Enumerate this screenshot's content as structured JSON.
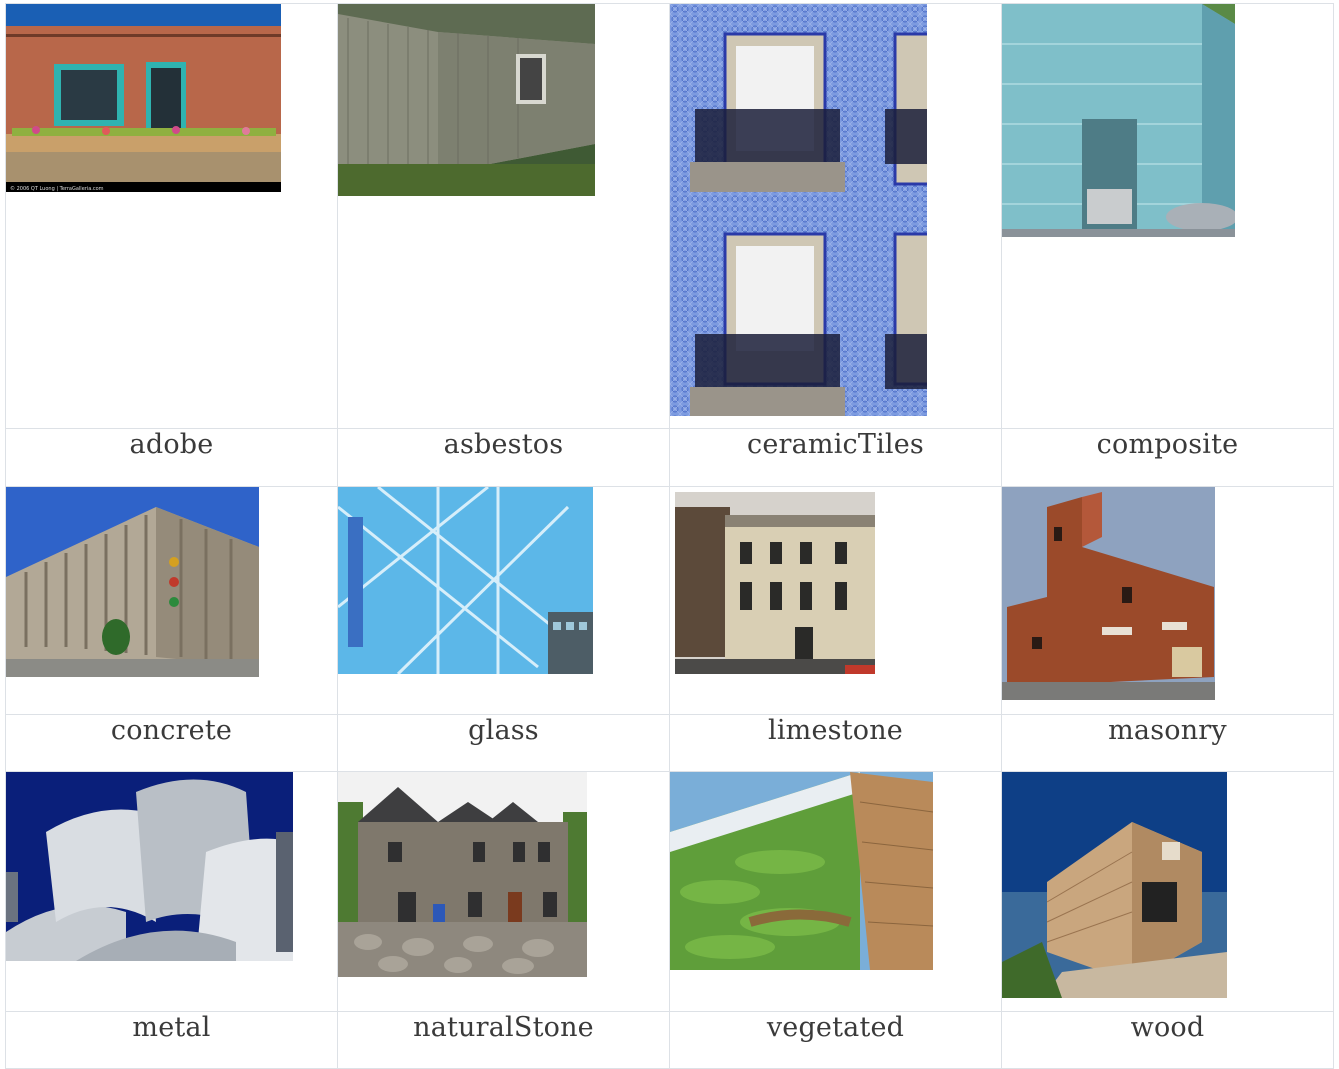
{
  "materials": [
    {
      "label": "adobe"
    },
    {
      "label": "asbestos"
    },
    {
      "label": "ceramicTiles"
    },
    {
      "label": "composite"
    },
    {
      "label": "concrete"
    },
    {
      "label": "glass"
    },
    {
      "label": "limestone"
    },
    {
      "label": "masonry"
    },
    {
      "label": "metal"
    },
    {
      "label": "naturalStone"
    },
    {
      "label": "vegetated"
    },
    {
      "label": "wood"
    }
  ],
  "photo_caption": {
    "adobe": "© 2006 QT Luong | TerraGalleria.com"
  },
  "colors": {
    "border": "#dde1e6",
    "label_text": "#3a3a3a"
  }
}
